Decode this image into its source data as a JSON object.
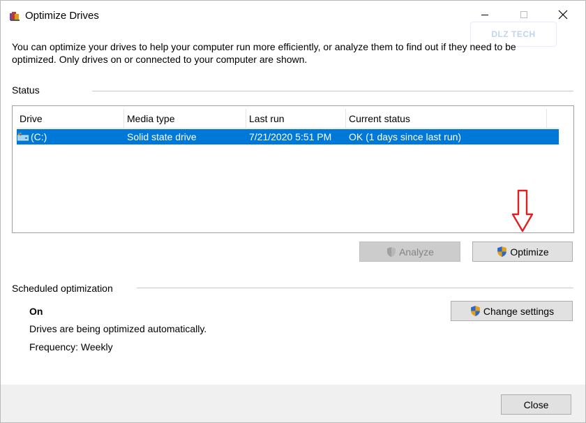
{
  "window": {
    "title": "Optimize Drives",
    "app_icon": "defrag-app-icon",
    "controls": {
      "minimize": "minimize-icon",
      "maximize": "maximize-icon",
      "close": "close-icon"
    }
  },
  "watermark": {
    "text": "DLZ TECH"
  },
  "intro": {
    "line1": "You can optimize your drives to help your computer run more efficiently, or analyze them to find out if they need to be",
    "line2": "optimized. Only drives on or connected to your computer are shown."
  },
  "status": {
    "group_label": "Status",
    "columns": [
      "Drive",
      "Media type",
      "Last run",
      "Current status"
    ],
    "rows": [
      {
        "drive": "(C:)",
        "media_type": "Solid state drive",
        "last_run": "7/21/2020 5:51 PM",
        "current_status": "OK (1 days since last run)",
        "selected": true
      }
    ]
  },
  "actions": {
    "analyze_label": "Analyze",
    "analyze_enabled": false,
    "optimize_label": "Optimize",
    "optimize_enabled": true
  },
  "scheduled": {
    "group_label": "Scheduled optimization",
    "state": "On",
    "description": "Drives are being optimized automatically.",
    "frequency": "Frequency: Weekly",
    "change_settings_label": "Change settings"
  },
  "footer": {
    "close_label": "Close"
  },
  "colors": {
    "selection": "#0078d7",
    "annotation_arrow": "#e02020"
  }
}
